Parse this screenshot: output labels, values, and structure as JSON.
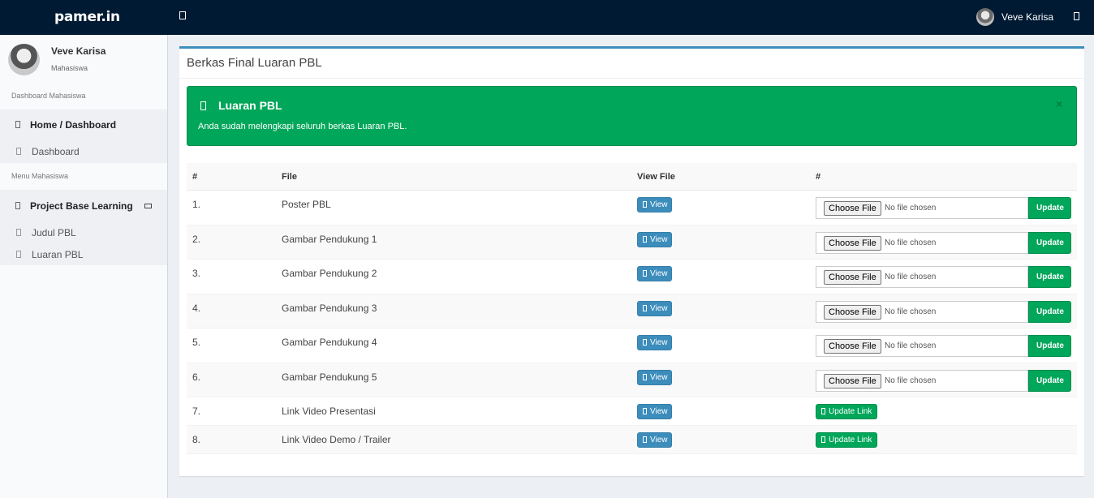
{
  "navbar": {
    "logo": "pamer.in",
    "user_name": "Veve Karisa"
  },
  "sidebar": {
    "user": {
      "name": "Veve Karisa",
      "role": "Mahasiswa"
    },
    "header_dashboard": "Dashboard Mahasiswa",
    "home_label": "Home / Dashboard",
    "dashboard_label": "Dashboard",
    "header_menu": "Menu Mahasiswa",
    "pbl_label": "Project Base Learning",
    "judul_label": "Judul PBL",
    "luaran_label": "Luaran PBL"
  },
  "main": {
    "box_title": "Berkas Final Luaran PBL",
    "alert": {
      "title": "Luaran PBL",
      "message": "Anda sudah melengkapi seluruh berkas Luaran PBL.",
      "close": "×"
    },
    "table": {
      "headers": [
        "#",
        "File",
        "View File",
        "#"
      ],
      "view_label": "View",
      "choose_label": "Choose File",
      "no_file_label": "No file chosen",
      "update_label": "Update",
      "update_link_label": "Update Link",
      "rows": [
        {
          "no": "1.",
          "file": "Poster PBL",
          "type": "file"
        },
        {
          "no": "2.",
          "file": "Gambar Pendukung 1",
          "type": "file"
        },
        {
          "no": "3.",
          "file": "Gambar Pendukung 2",
          "type": "file"
        },
        {
          "no": "4.",
          "file": "Gambar Pendukung 3",
          "type": "file"
        },
        {
          "no": "5.",
          "file": "Gambar Pendukung 4",
          "type": "file"
        },
        {
          "no": "6.",
          "file": "Gambar Pendukung 5",
          "type": "file"
        },
        {
          "no": "7.",
          "file": "Link Video Presentasi",
          "type": "link"
        },
        {
          "no": "8.",
          "file": "Link Video Demo / Trailer",
          "type": "link"
        }
      ]
    }
  },
  "colors": {
    "navbar": "#001a33",
    "primary": "#3c8dbc",
    "success": "#00a65a"
  }
}
